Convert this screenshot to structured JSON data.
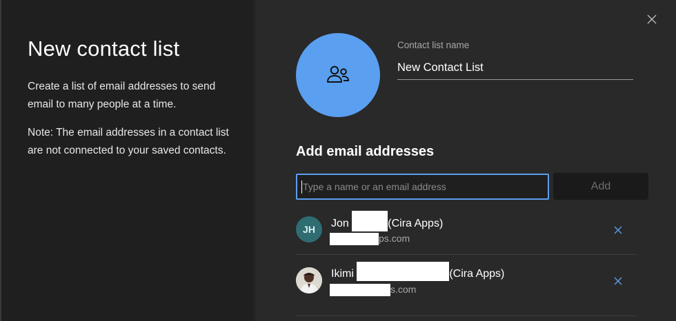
{
  "left": {
    "title": "New contact list",
    "description_1": "Create a list of email addresses to send email to many people at a time.",
    "description_2": "Note: The email addresses in a contact list are not connected to your saved contacts."
  },
  "form": {
    "name_label": "Contact list name",
    "name_value": "New Contact List",
    "section_title": "Add email addresses",
    "email_placeholder": "Type a name or an email address",
    "add_label": "Add"
  },
  "contacts": [
    {
      "initials": "JH",
      "name_first": "Jon",
      "name_org": "(Cira Apps)",
      "email_tail": "ps.com"
    },
    {
      "initials": "",
      "name_first": "Ikimi",
      "name_org": "(Cira Apps)",
      "email_tail": "s.com"
    }
  ],
  "colors": {
    "accent": "#5a9ff0",
    "avatar_teal": "#2f6d73"
  },
  "icons": {
    "close": "close-icon",
    "group": "people-icon",
    "remove": "remove-icon"
  }
}
